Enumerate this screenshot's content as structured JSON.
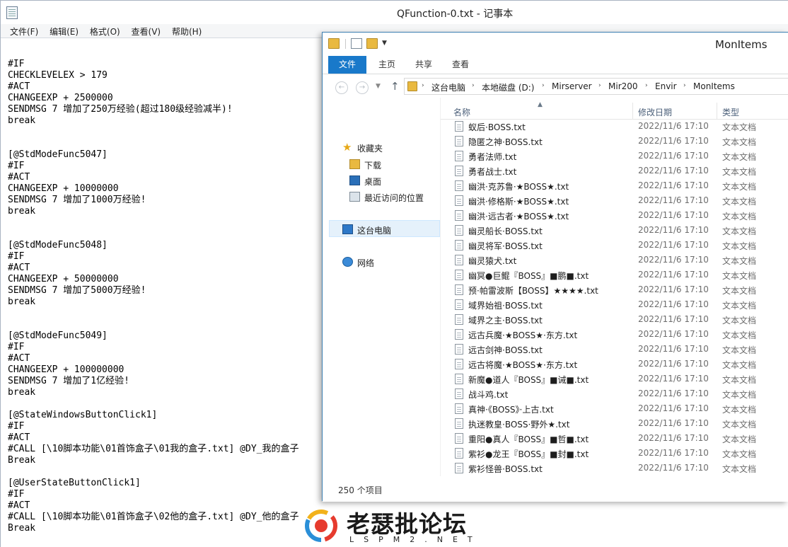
{
  "notepad": {
    "title": "QFunction-0.txt - 记事本",
    "menu": [
      "文件(F)",
      "编辑(E)",
      "格式(O)",
      "查看(V)",
      "帮助(H)"
    ],
    "lines": [
      "",
      "#IF",
      "CHECKLEVELEX > 179",
      "#ACT",
      "CHANGEEXP + 2500000",
      "SENDMSG 7 增加了250万经验(超过180级经验减半)!",
      "break",
      "",
      "",
      "[@StdModeFunc5047]",
      "#IF",
      "#ACT",
      "CHANGEEXP + 10000000",
      "SENDMSG 7 增加了1000万经验!",
      "break",
      "",
      "",
      "[@StdModeFunc5048]",
      "#IF",
      "#ACT",
      "CHANGEEXP + 50000000",
      "SENDMSG 7 增加了5000万经验!",
      "break",
      "",
      "",
      "[@StdModeFunc5049]",
      "#IF",
      "#ACT",
      "CHANGEEXP + 100000000",
      "SENDMSG 7 增加了1亿经验!",
      "break",
      "",
      "[@StateWindowsButtonClick1]",
      "#IF",
      "#ACT",
      "#CALL [\\10脚本功能\\01首饰盒子\\01我的盒子.txt] @DY_我的盒子",
      "Break",
      "",
      "[@UserStateButtonClick1]",
      "#IF",
      "#ACT",
      "#CALL [\\10脚本功能\\01首饰盒子\\02他的盒子.txt] @DY_他的盒子",
      "Break"
    ]
  },
  "explorer": {
    "title": "MonItems",
    "ribbon_tabs": [
      "文件",
      "主页",
      "共享",
      "查看"
    ],
    "breadcrumb": [
      "这台电脑",
      "本地磁盘 (D:)",
      "Mirserver",
      "Mir200",
      "Envir",
      "MonItems"
    ],
    "nav": {
      "favorites": "收藏夹",
      "downloads": "下载",
      "desktop": "桌面",
      "recent": "最近访问的位置",
      "this_pc": "这台电脑",
      "network": "网络"
    },
    "columns": {
      "name": "名称",
      "date": "修改日期",
      "type": "类型"
    },
    "files": [
      {
        "name": "蚁后·BOSS.txt",
        "date": "2022/11/6 17:10",
        "type": "文本文档"
      },
      {
        "name": "隐匿之神·BOSS.txt",
        "date": "2022/11/6 17:10",
        "type": "文本文档"
      },
      {
        "name": "勇者法师.txt",
        "date": "2022/11/6 17:10",
        "type": "文本文档"
      },
      {
        "name": "勇者战士.txt",
        "date": "2022/11/6 17:10",
        "type": "文本文档"
      },
      {
        "name": "幽洪·克苏鲁·★BOSS★.txt",
        "date": "2022/11/6 17:10",
        "type": "文本文档"
      },
      {
        "name": "幽洪·修格斯·★BOSS★.txt",
        "date": "2022/11/6 17:10",
        "type": "文本文档"
      },
      {
        "name": "幽洪·远古者·★BOSS★.txt",
        "date": "2022/11/6 17:10",
        "type": "文本文档"
      },
      {
        "name": "幽灵船长·BOSS.txt",
        "date": "2022/11/6 17:10",
        "type": "文本文档"
      },
      {
        "name": "幽灵将军·BOSS.txt",
        "date": "2022/11/6 17:10",
        "type": "文本文档"
      },
      {
        "name": "幽灵猿犬.txt",
        "date": "2022/11/6 17:10",
        "type": "文本文档"
      },
      {
        "name": "幽冥●巨鲲『BOSS』■鹏■.txt",
        "date": "2022/11/6 17:10",
        "type": "文本文档"
      },
      {
        "name": "预·帕雷波斯【BOSS】★★★★.txt",
        "date": "2022/11/6 17:10",
        "type": "文本文档"
      },
      {
        "name": "域界始祖·BOSS.txt",
        "date": "2022/11/6 17:10",
        "type": "文本文档"
      },
      {
        "name": "域界之主·BOSS.txt",
        "date": "2022/11/6 17:10",
        "type": "文本文档"
      },
      {
        "name": "远古兵魔·★BOSS★·东方.txt",
        "date": "2022/11/6 17:10",
        "type": "文本文档"
      },
      {
        "name": "远古剑神·BOSS.txt",
        "date": "2022/11/6 17:10",
        "type": "文本文档"
      },
      {
        "name": "远古将魔·★BOSS★·东方.txt",
        "date": "2022/11/6 17:10",
        "type": "文本文档"
      },
      {
        "name": "新魔●道人『BOSS』■诫■.txt",
        "date": "2022/11/6 17:10",
        "type": "文本文档"
      },
      {
        "name": "战斗鸡.txt",
        "date": "2022/11/6 17:10",
        "type": "文本文档"
      },
      {
        "name": "真神·《BOSS》·上古.txt",
        "date": "2022/11/6 17:10",
        "type": "文本文档"
      },
      {
        "name": "执迷教皇·BOSS·野外★.txt",
        "date": "2022/11/6 17:10",
        "type": "文本文档"
      },
      {
        "name": "重阳●真人『BOSS』■哲■.txt",
        "date": "2022/11/6 17:10",
        "type": "文本文档"
      },
      {
        "name": "紫衫●龙王『BOSS』■封■.txt",
        "date": "2022/11/6 17:10",
        "type": "文本文档"
      },
      {
        "name": "紫衫怪兽·BOSS.txt",
        "date": "2022/11/6 17:10",
        "type": "文本文档"
      }
    ],
    "status": "250 个项目"
  },
  "watermark": {
    "text": "老瑟批论坛",
    "sub": "LSPM2.NET"
  }
}
